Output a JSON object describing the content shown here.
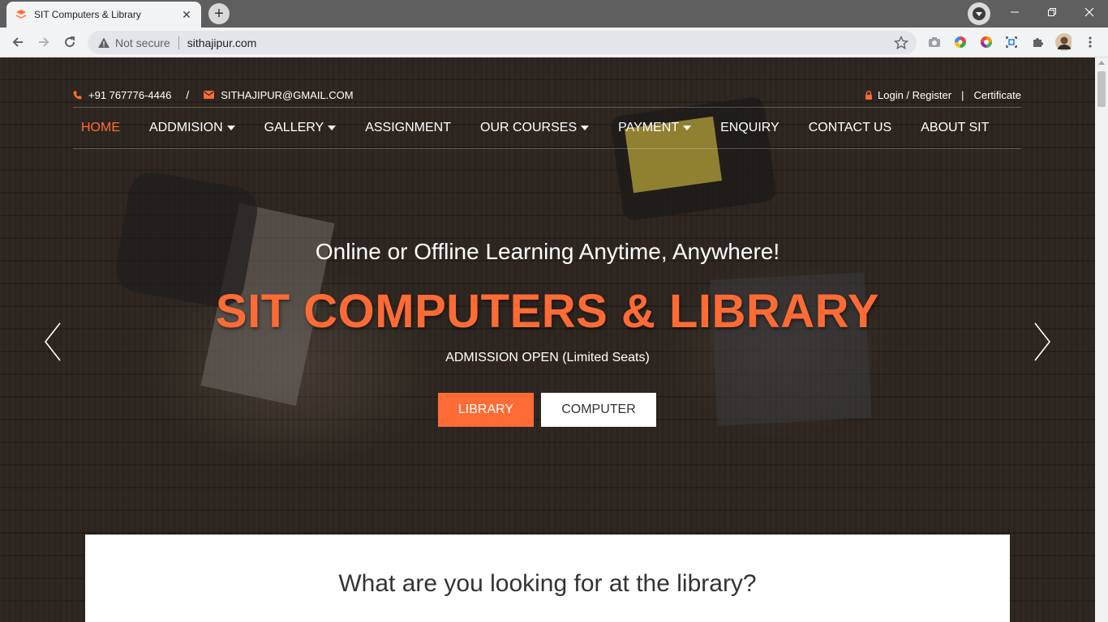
{
  "browser": {
    "tab_title": "SIT Computers & Library",
    "not_secure": "Not secure",
    "url": "sithajipur.com"
  },
  "topbar": {
    "phone": "+91 767776-4446",
    "divider": "/",
    "email": "SITHAJIPUR@GMAIL.COM",
    "login": "Login / Register",
    "separator": "|",
    "certificate": "Certificate"
  },
  "nav": {
    "items": [
      {
        "label": "HOME",
        "dropdown": false,
        "active": true
      },
      {
        "label": "ADDMISION",
        "dropdown": true,
        "active": false
      },
      {
        "label": "GALLERY",
        "dropdown": true,
        "active": false
      },
      {
        "label": "ASSIGNMENT",
        "dropdown": false,
        "active": false
      },
      {
        "label": "OUR COURSES",
        "dropdown": true,
        "active": false
      },
      {
        "label": "PAYMENT",
        "dropdown": true,
        "active": false
      },
      {
        "label": "ENQUIRY",
        "dropdown": false,
        "active": false
      },
      {
        "label": "CONTACT US",
        "dropdown": false,
        "active": false
      },
      {
        "label": "ABOUT SIT",
        "dropdown": false,
        "active": false
      }
    ]
  },
  "hero": {
    "subtitle": "Online or Offline Learning Anytime, Anywhere!",
    "title": "SIT COMPUTERS & LIBRARY",
    "admission": "ADMISSION OPEN (Limited Seats)",
    "btn_library": "LIBRARY",
    "btn_computer": "COMPUTER"
  },
  "card": {
    "title": "What are you looking for at the library?"
  },
  "colors": {
    "accent": "#ff6b35"
  }
}
